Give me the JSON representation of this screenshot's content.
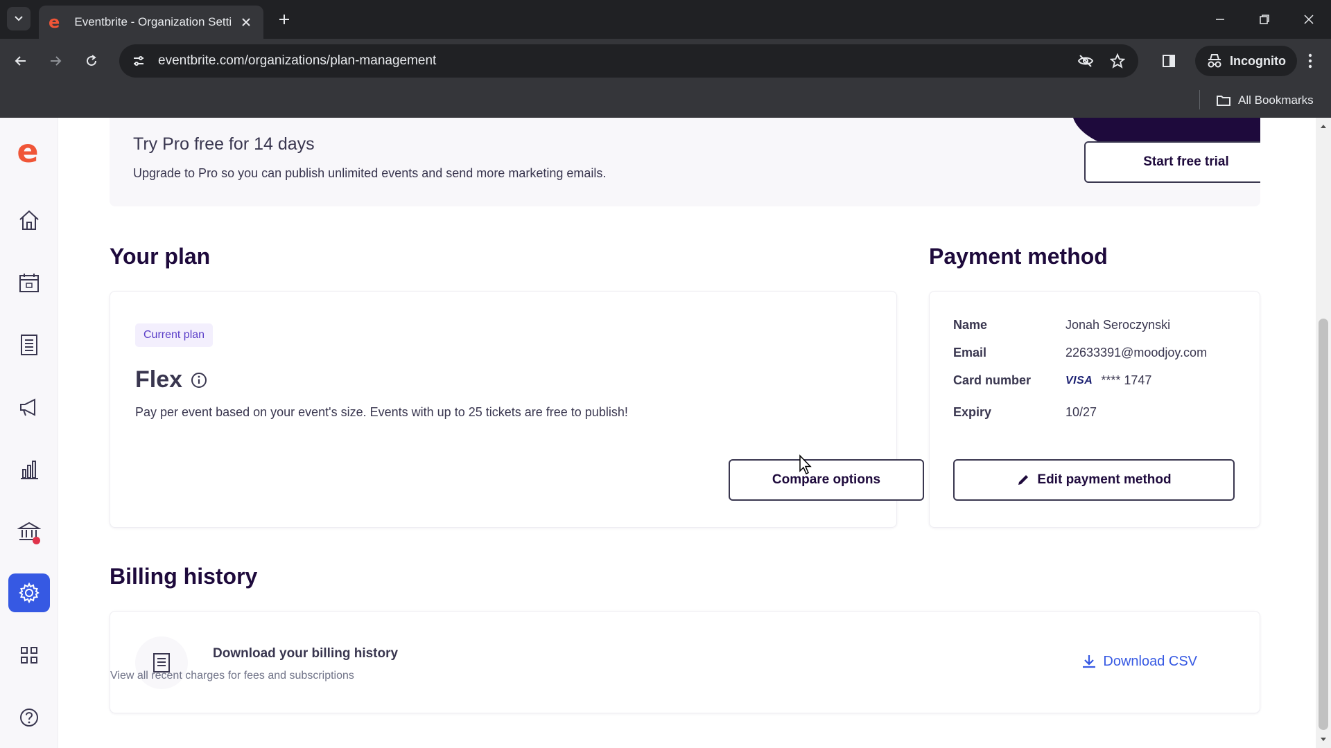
{
  "browser": {
    "tab_title": "Eventbrite - Organization Setti",
    "url": "eventbrite.com/organizations/plan-management",
    "incognito_label": "Incognito",
    "all_bookmarks_label": "All Bookmarks"
  },
  "sidebar": {
    "logo": "e",
    "items": [
      {
        "name": "home",
        "icon": "home-icon"
      },
      {
        "name": "events",
        "icon": "calendar-icon"
      },
      {
        "name": "orders",
        "icon": "receipt-icon"
      },
      {
        "name": "marketing",
        "icon": "megaphone-icon"
      },
      {
        "name": "reports",
        "icon": "bar-chart-icon"
      },
      {
        "name": "finance",
        "icon": "bank-icon"
      },
      {
        "name": "settings",
        "icon": "gear-icon",
        "active": true
      },
      {
        "name": "apps",
        "icon": "grid-icon"
      },
      {
        "name": "help",
        "icon": "help-icon"
      }
    ]
  },
  "promo": {
    "title": "Try Pro free for 14 days",
    "subtitle": "Upgrade to Pro so you can publish unlimited events and send more marketing emails.",
    "button_label": "Start free trial"
  },
  "your_plan": {
    "heading": "Your plan",
    "badge": "Current plan",
    "plan_name": "Flex",
    "description": "Pay per event based on your event's size. Events with up to 25 tickets are free to publish!",
    "compare_label": "Compare options"
  },
  "payment": {
    "heading": "Payment method",
    "name_label": "Name",
    "name_value": "Jonah Seroczynski",
    "email_label": "Email",
    "email_value": "22633391@moodjoy.com",
    "card_label": "Card number",
    "card_brand": "VISA",
    "card_value": "**** 1747",
    "expiry_label": "Expiry",
    "expiry_value": "10/27",
    "edit_label": "Edit payment method"
  },
  "billing": {
    "heading": "Billing history",
    "title": "Download your billing history",
    "subtitle": "View all recent charges for fees and subscriptions",
    "download_label": "Download CSV"
  },
  "colors": {
    "accent": "#3659e3",
    "brand": "#f05537",
    "text_dark": "#1e0a3c",
    "badge_bg": "#f3effd"
  }
}
